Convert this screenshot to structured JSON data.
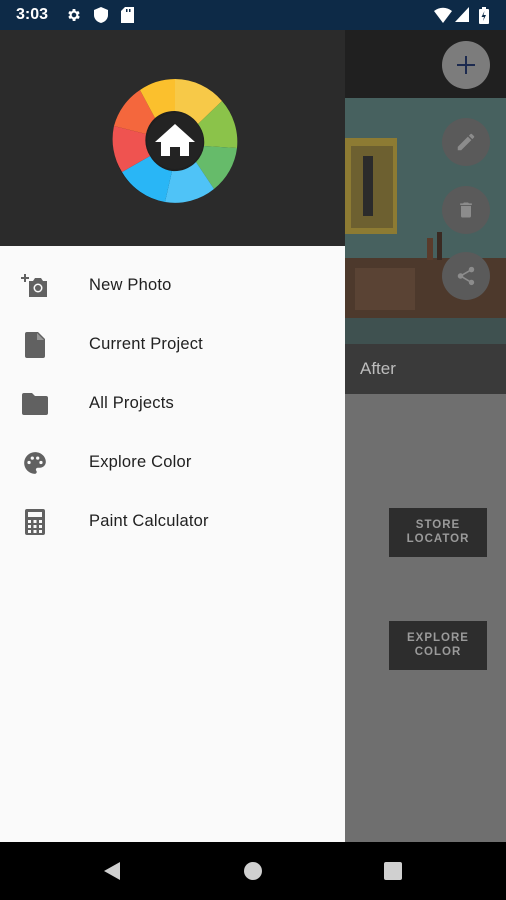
{
  "status_bar": {
    "time": "3:03",
    "icons": [
      "settings-icon",
      "shield-icon",
      "sd-card-icon",
      "wifi-icon",
      "signal-icon",
      "battery-icon"
    ]
  },
  "app": {
    "after_label": "After",
    "actions": [
      "add-icon",
      "edit-icon",
      "delete-icon",
      "share-icon"
    ],
    "store_locator": [
      "STORE",
      "LOCATOR"
    ],
    "explore_color": [
      "EXPLORE",
      "COLOR"
    ]
  },
  "drawer": {
    "items": [
      {
        "label": "New Photo",
        "icon": "add-photo-icon"
      },
      {
        "label": "Current Project",
        "icon": "document-icon"
      },
      {
        "label": "All Projects",
        "icon": "folder-icon"
      },
      {
        "label": "Explore Color",
        "icon": "palette-icon"
      },
      {
        "label": "Paint Calculator",
        "icon": "calculator-icon"
      }
    ]
  },
  "nav_bar": {
    "buttons": [
      "back-icon",
      "home-icon",
      "recents-icon"
    ]
  },
  "colors": {
    "status_bar": "#0d2a47",
    "drawer_header": "#2b2b2b",
    "drawer_bg": "#fafafa",
    "scrim": "#6f6f6f"
  }
}
